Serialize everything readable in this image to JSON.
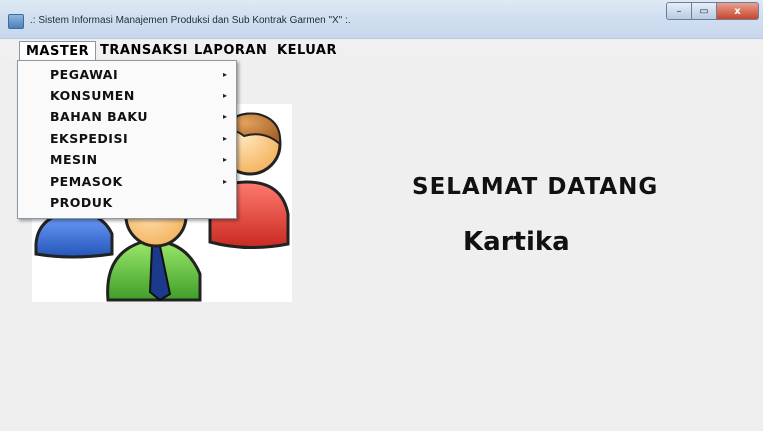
{
  "window": {
    "title": ".: Sistem Informasi Manajemen Produksi dan Sub Kontrak Garmen \"X\" :.",
    "controls": {
      "minimize": "–",
      "maximize": "▭",
      "close": "x"
    }
  },
  "menubar": {
    "items": [
      {
        "label": "MASTER"
      },
      {
        "label": "TRANSAKSI"
      },
      {
        "label": "LAPORAN"
      },
      {
        "label": "KELUAR"
      }
    ]
  },
  "master_menu": {
    "items": [
      {
        "label": "PEGAWAI",
        "submenu_arrow": "▸"
      },
      {
        "label": "KONSUMEN",
        "submenu_arrow": "▸"
      },
      {
        "label": "BAHAN BAKU",
        "submenu_arrow": "▸"
      },
      {
        "label": "EKSPEDISI",
        "submenu_arrow": "▸"
      },
      {
        "label": "MESIN",
        "submenu_arrow": "▸"
      },
      {
        "label": "PEMASOK",
        "submenu_arrow": "▸"
      },
      {
        "label": "PRODUK",
        "submenu_arrow": ""
      }
    ]
  },
  "main": {
    "welcome_text": "SELAMAT DATANG",
    "username": "Kartika",
    "illustration_icon": "users-group-icon"
  }
}
